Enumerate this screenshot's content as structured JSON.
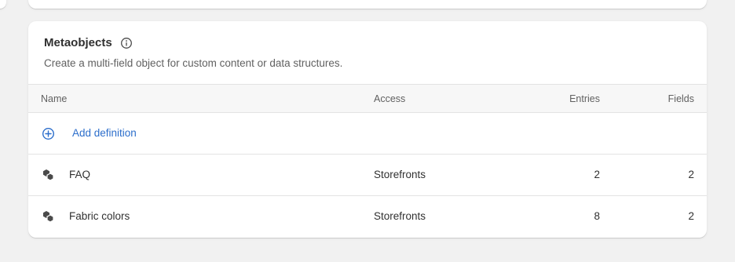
{
  "section": {
    "title": "Metaobjects",
    "description": "Create a multi-field object for custom content or data structures."
  },
  "table": {
    "headers": {
      "name": "Name",
      "access": "Access",
      "entries": "Entries",
      "fields": "Fields"
    },
    "add_label": "Add definition",
    "rows": [
      {
        "name": "FAQ",
        "access": "Storefronts",
        "entries": "2",
        "fields": "2"
      },
      {
        "name": "Fabric colors",
        "access": "Storefronts",
        "entries": "8",
        "fields": "2"
      }
    ]
  },
  "icons": {
    "info": "info-circle-icon",
    "add": "plus-circle-icon",
    "metaobject": "metaobject-icon"
  },
  "colors": {
    "link": "#2c6ecb",
    "background": "#f1f1f1",
    "card": "#ffffff",
    "header_row": "#f7f7f7",
    "border": "#e3e3e3",
    "icon": "#4a4a4a"
  }
}
